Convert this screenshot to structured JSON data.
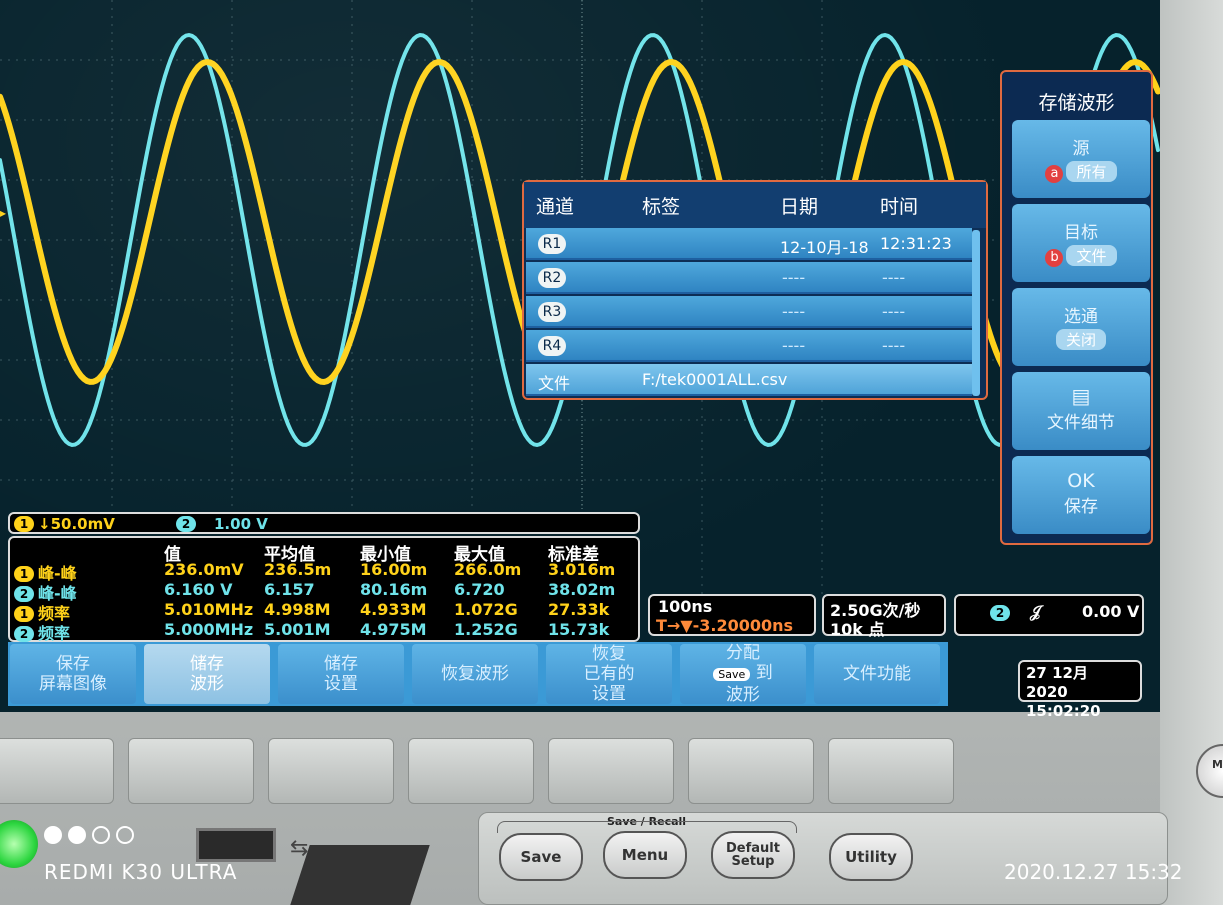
{
  "dialog": {
    "headers": [
      "通道",
      "标签",
      "日期",
      "时间"
    ],
    "rows": [
      {
        "ch": "R1",
        "date": "12-10月-18",
        "time": "12:31:23"
      },
      {
        "ch": "R2",
        "date": "----",
        "time": "----"
      },
      {
        "ch": "R3",
        "date": "----",
        "time": "----"
      },
      {
        "ch": "R4",
        "date": "----",
        "time": "----"
      }
    ],
    "file_label": "文件",
    "file_path": "F:/tek0001ALL.csv"
  },
  "side_menu": {
    "title": "存储波形",
    "items": [
      {
        "label": "源",
        "bullet": "a",
        "option": "所有"
      },
      {
        "label": "目标",
        "bullet": "b",
        "option": "文件"
      },
      {
        "label": "选通",
        "option": "关闭"
      },
      {
        "label": "文件细节"
      },
      {
        "label": "OK",
        "sub": "保存"
      }
    ]
  },
  "channels": {
    "ch1": {
      "num": "1",
      "scale": "↓50.0mV"
    },
    "ch2": {
      "num": "2",
      "scale": "1.00 V"
    }
  },
  "measurements": {
    "headers": [
      "值",
      "平均值",
      "最小值",
      "最大值",
      "标准差"
    ],
    "rows": [
      {
        "ch": "1",
        "name": "峰-峰",
        "val": "236.0mV",
        "mean": "236.5m",
        "min": "16.00m",
        "max": "266.0m",
        "std": "3.016m"
      },
      {
        "ch": "2",
        "name": "峰-峰",
        "val": "6.160 V",
        "mean": "6.157",
        "min": "80.16m",
        "max": "6.720",
        "std": "38.02m"
      },
      {
        "ch": "1",
        "name": "频率",
        "val": "5.010MHz",
        "mean": "4.998M",
        "min": "4.933M",
        "max": "1.072G",
        "std": "27.33k"
      },
      {
        "ch": "2",
        "name": "频率",
        "val": "5.000MHz",
        "mean": "5.001M",
        "min": "4.975M",
        "max": "1.252G",
        "std": "15.73k"
      }
    ]
  },
  "timebase": {
    "scale": "100ns",
    "delay": "-3.20000ns",
    "delay_prefix": "T→▼"
  },
  "acquisition": {
    "rate": "2.50G次/秒",
    "points": "10k 点"
  },
  "trigger": {
    "ch": "2",
    "slope": "𝒥",
    "level": "0.00 V"
  },
  "bottom_menu": [
    {
      "l1": "保存",
      "l2": "屏幕图像"
    },
    {
      "l1": "储存",
      "l2": "波形"
    },
    {
      "l1": "储存",
      "l2": "设置"
    },
    {
      "l1": "恢复波形",
      "l2": ""
    },
    {
      "l1": "恢复",
      "l2": "已有的",
      "l3": "设置"
    },
    {
      "l1": "分配",
      "save": "Save",
      "l2": "到",
      "l3": "波形"
    },
    {
      "l1": "文件功能",
      "l2": ""
    }
  ],
  "datetime": {
    "date": "27 12月 2020",
    "time": "15:02:20"
  },
  "hardware": {
    "group_label": "Save / Recall",
    "keys": [
      "Save",
      "Menu",
      "Default Setup",
      "Utility"
    ],
    "knob": "Me"
  },
  "photo_overlay": {
    "brand": "REDMI K30 ULTRA",
    "timestamp": "2020.12.27 15:32"
  },
  "colors": {
    "ch1": "#ffd21a",
    "ch2": "#6fe3ea",
    "accent": "#e06a40",
    "menu": "#3b9ad6"
  }
}
